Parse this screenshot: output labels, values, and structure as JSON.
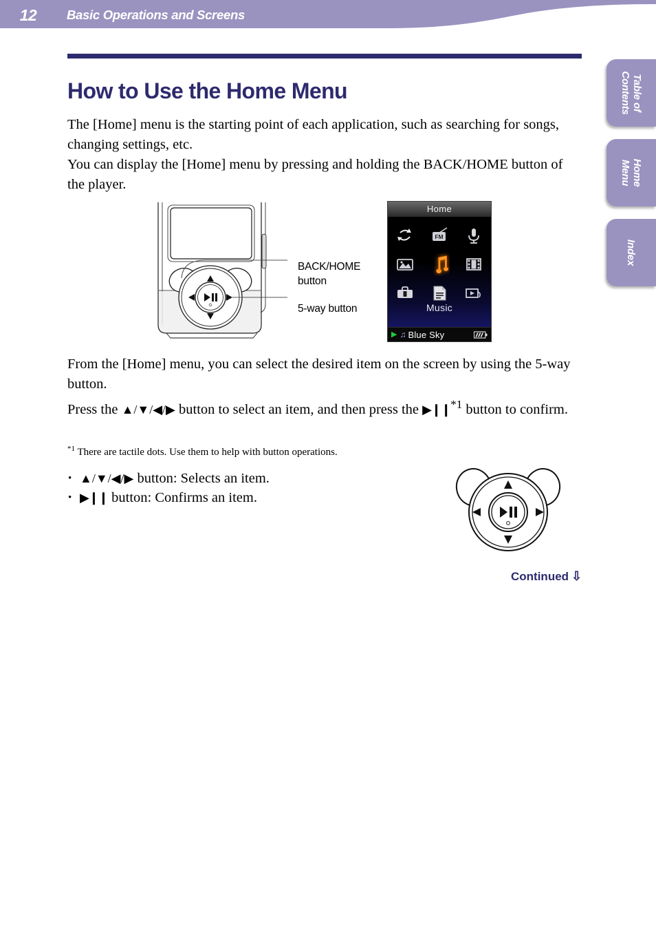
{
  "header": {
    "page_number": "12",
    "chapter_title": "Basic Operations and Screens",
    "band_color": "#9a93c0"
  },
  "side_tabs": [
    {
      "name": "table-of-contents",
      "label": "Table of\nContents"
    },
    {
      "name": "home-menu",
      "label": "Home\nMenu"
    },
    {
      "name": "index",
      "label": "Index"
    }
  ],
  "section": {
    "title": "How to Use the Home Menu",
    "accent_color": "#2e2a6e",
    "intro_paragraph": "The [Home] menu is the starting point of each application, such as searching for songs, changing settings, etc.\nYou can display the [Home] menu by pressing and holding the BACK/HOME button of the player.",
    "select_paragraph_line1": "From the [Home] menu, you can select the desired item on the screen by using the 5-way button.",
    "footnote_marker": "*1",
    "footnote_text": "There are tactile dots. Use them to help with button operations."
  },
  "body_parts": {
    "press_prefix": "Press the ",
    "press_arrows": "▲/▼/◀/▶",
    "press_middle": " button to select an item, and then press the ",
    "press_playpause": "▶❙❙",
    "press_sup": "*1",
    "press_suffix": " button to confirm."
  },
  "bullets": [
    {
      "icon_text": "▲/▼/◀/▶",
      "label": " button: Selects an item."
    },
    {
      "icon_text": "▶❙❙",
      "label": " button: Confirms an item."
    }
  ],
  "callouts": {
    "back_home": "BACK/HOME\nbutton",
    "five_way": "5-way button"
  },
  "device_screen": {
    "title": "Home",
    "selected_label": "Music",
    "icons": [
      {
        "name": "loop-arrow-icon",
        "row": 1,
        "col": 1,
        "selected": false
      },
      {
        "name": "fm-radio-icon",
        "row": 1,
        "col": 2,
        "selected": false
      },
      {
        "name": "microphone-icon",
        "row": 1,
        "col": 3,
        "selected": false
      },
      {
        "name": "photo-icon",
        "row": 2,
        "col": 1,
        "selected": false
      },
      {
        "name": "music-note-icon",
        "row": 2,
        "col": 2,
        "selected": true
      },
      {
        "name": "video-film-icon",
        "row": 2,
        "col": 3,
        "selected": false
      },
      {
        "name": "toolbox-icon",
        "row": 3,
        "col": 1,
        "selected": false
      },
      {
        "name": "document-icon",
        "row": 3,
        "col": 2,
        "selected": false
      },
      {
        "name": "playlist-icon",
        "row": 3,
        "col": 3,
        "selected": false
      }
    ],
    "status_bar": {
      "play_glyph": "▶",
      "note_glyph": "♫",
      "track_title": "Blue Sky",
      "battery_level": "full"
    },
    "selection_color": "#ff9933"
  },
  "footer": {
    "continued_label": "Continued",
    "continued_arrow": "⇩"
  }
}
